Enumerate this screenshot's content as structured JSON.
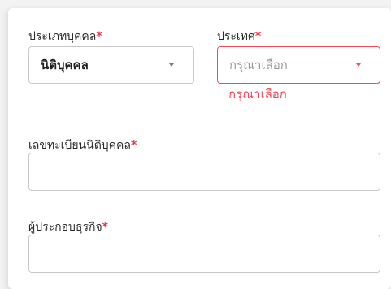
{
  "form": {
    "person_type": {
      "label": "ประเภทบุคคล",
      "required_mark": "*",
      "selected_value": "นิติบุคคล"
    },
    "country": {
      "label": "ประเทศ",
      "required_mark": "*",
      "placeholder": "กรุณาเลือก",
      "error_message": "กรุณาเลือก"
    },
    "registration_number": {
      "label": "เลขทะเบียนนิติบุคคล",
      "required_mark": "*",
      "value": ""
    },
    "business_operator": {
      "label": "ผู้ประกอบธุรกิจ",
      "required_mark": "*",
      "value": ""
    }
  },
  "colors": {
    "required": "#e8364b",
    "error": "#ef4c5c",
    "border": "#c9c9c9"
  },
  "icons": {
    "dropdown": "caret-down-icon"
  }
}
